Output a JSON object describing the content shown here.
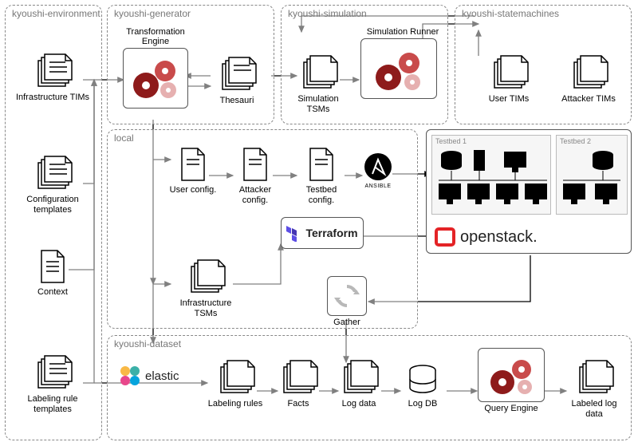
{
  "panels": {
    "environment": "kyoushi-environment",
    "generator": "kyoushi-generator",
    "simulation": "kyoushi-simulation",
    "statemachines": "kyoushi-statemachines",
    "local": "local",
    "dataset": "kyoushi-dataset"
  },
  "nodes": {
    "infra_tims": "Infrastructure TIMs",
    "config_templates": "Configuration templates",
    "context": "Context",
    "labeling_templates": "Labeling rule templates",
    "transform_engine": "Transformation Engine",
    "thesauri": "Thesauri",
    "sim_tsms": "Simulation TSMs",
    "sim_runner": "Simulation Runner",
    "user_tims": "User TIMs",
    "attacker_tims": "Attacker TIMs",
    "user_config": "User config.",
    "attacker_config": "Attacker config.",
    "testbed_config": "Testbed config.",
    "infra_tsms": "Infrastructure TSMs",
    "gather": "Gather",
    "elastic": "elastic",
    "labeling_rules": "Labeling rules",
    "facts": "Facts",
    "log_data": "Log data",
    "log_db": "Log DB",
    "query_engine": "Query Engine",
    "labeled_log_data": "Labeled log data",
    "ansible": "ANSIBLE",
    "terraform": "Terraform",
    "openstack": "openstack.",
    "testbed1": "Testbed 1",
    "testbed2": "Testbed 2"
  }
}
